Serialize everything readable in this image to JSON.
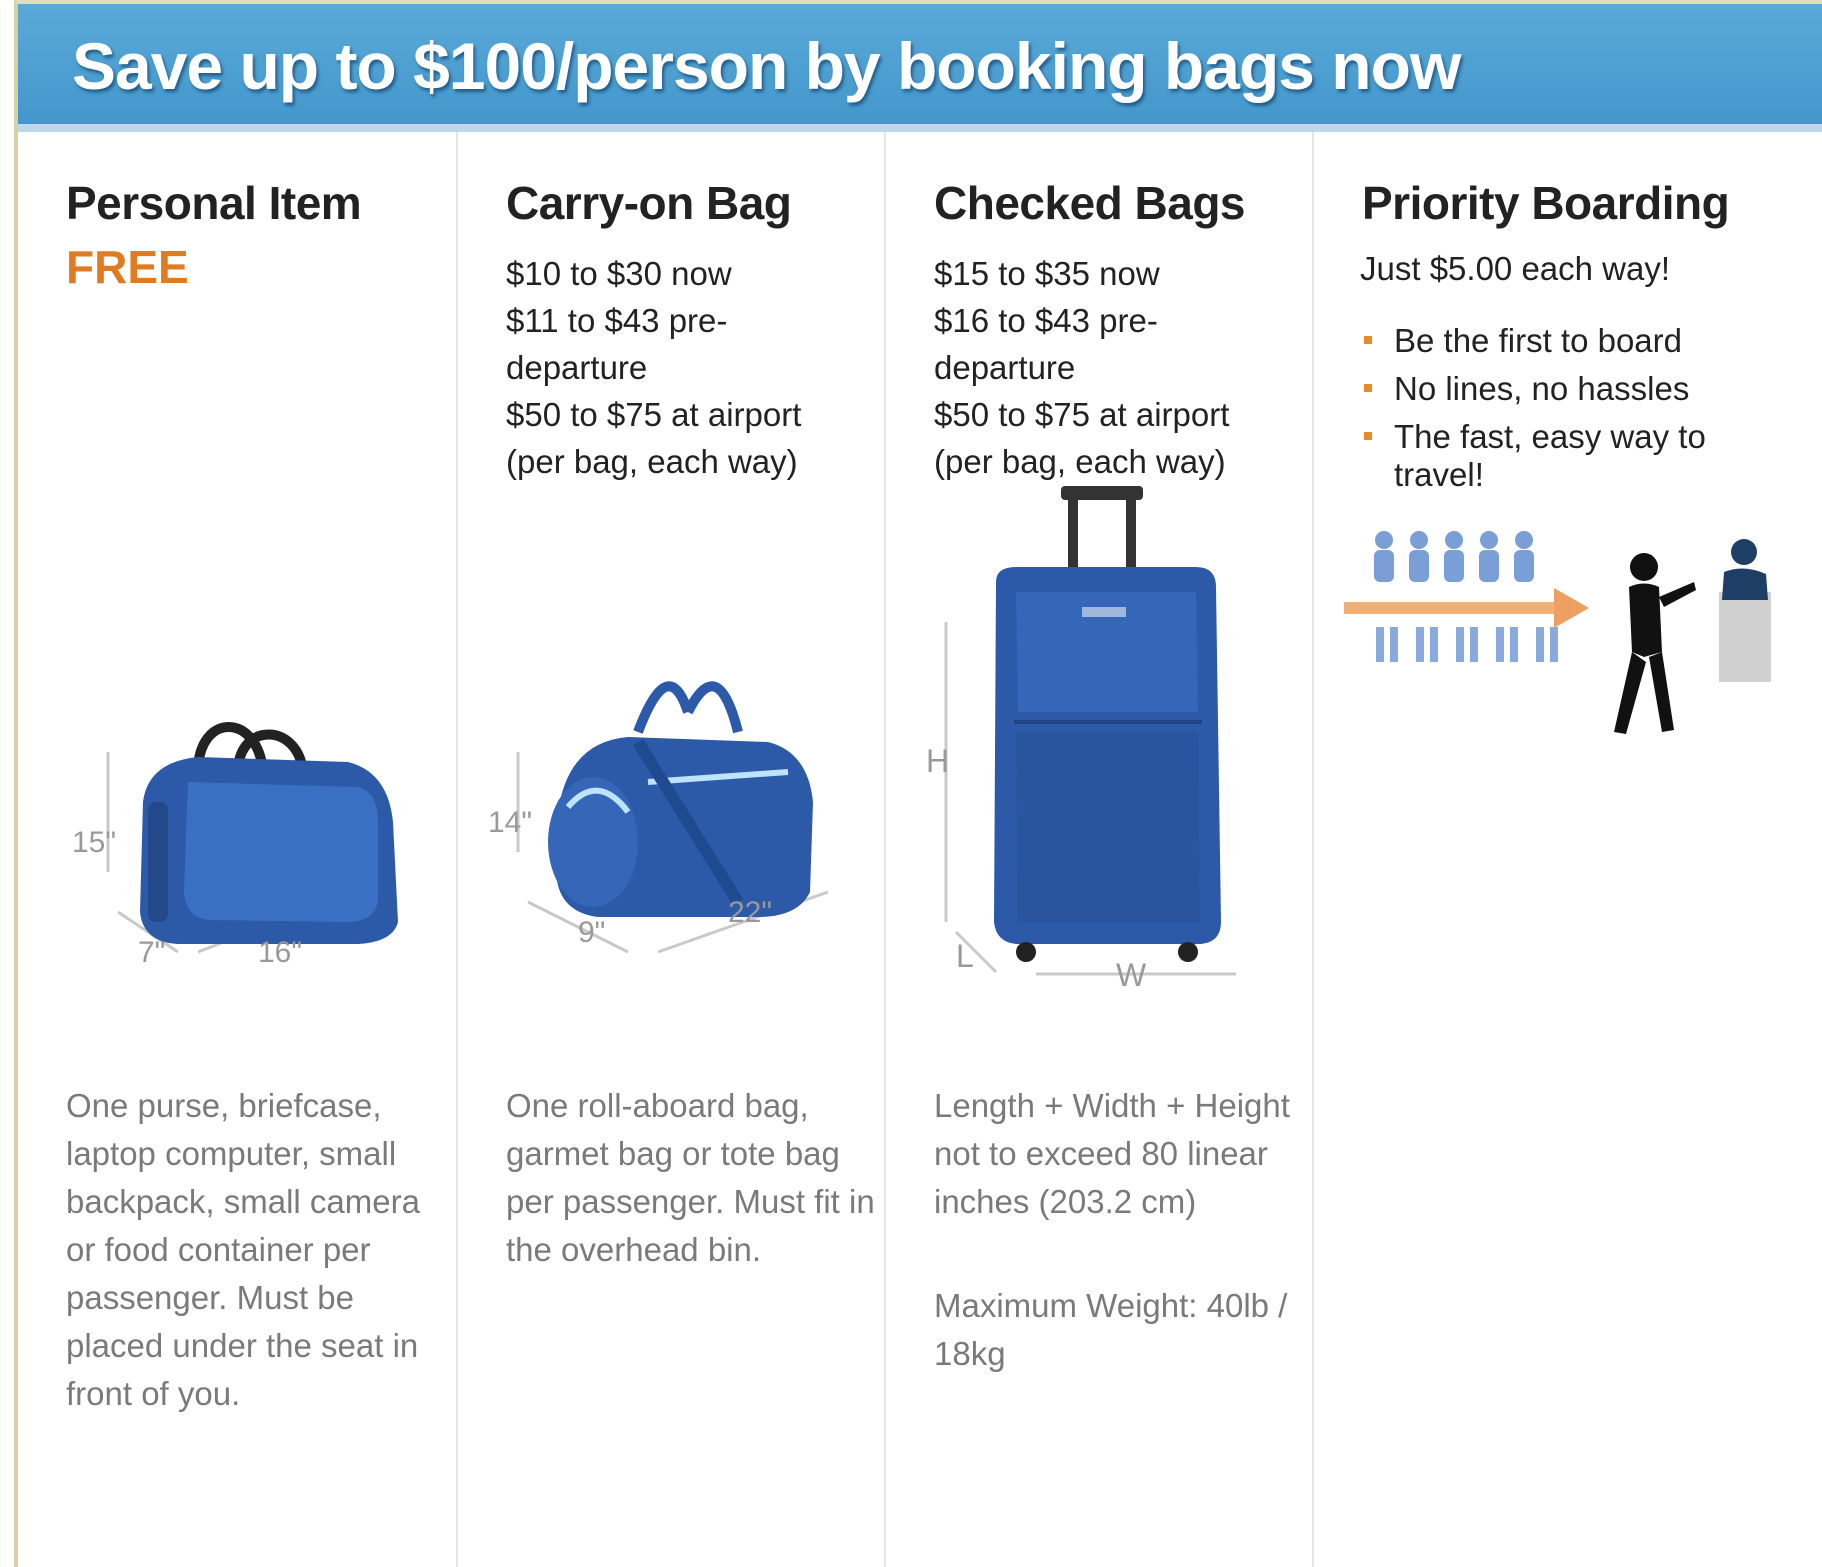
{
  "banner": {
    "title": "Save up to $100/person by booking bags now"
  },
  "columns": {
    "personal": {
      "title": "Personal Item",
      "price": "FREE",
      "dims": {
        "height": "15\"",
        "depth": "7\"",
        "width": "16\""
      },
      "description": "One purse, briefcase, laptop computer, small backpack, small camera or food container per passenger. Must be placed under the seat in front of you."
    },
    "carryon": {
      "title": "Carry-on Bag",
      "price_lines": [
        "$10 to $30 now",
        "$11 to $43 pre-",
        "departure",
        "$50 to $75 at airport",
        "(per bag, each way)"
      ],
      "dims": {
        "height": "14\"",
        "depth": "9\"",
        "width": "22\""
      },
      "description": "One roll-aboard bag, garmet bag or tote bag per passenger. Must fit in the overhead bin."
    },
    "checked": {
      "title": "Checked Bags",
      "price_lines": [
        "$15 to $35 now",
        "$16 to $43 pre-",
        "departure",
        "$50 to $75 at airport",
        "(per bag, each way)"
      ],
      "dims": {
        "height": "H",
        "depth": "L",
        "width": "W"
      },
      "description": "Length + Width + Height not to exceed 80 linear inches (203.2 cm)",
      "weight": "Maximum Weight: 40lb / 18kg"
    },
    "priority": {
      "title": "Priority Boarding",
      "lead": "Just $5.00 each way!",
      "bullets": [
        "Be the first to board",
        "No lines, no hassles",
        "The fast, easy way to travel!"
      ]
    }
  },
  "colors": {
    "banner": "#4a9fd3",
    "accent_orange": "#e07b22",
    "bag_blue": "#2c5aa8"
  }
}
